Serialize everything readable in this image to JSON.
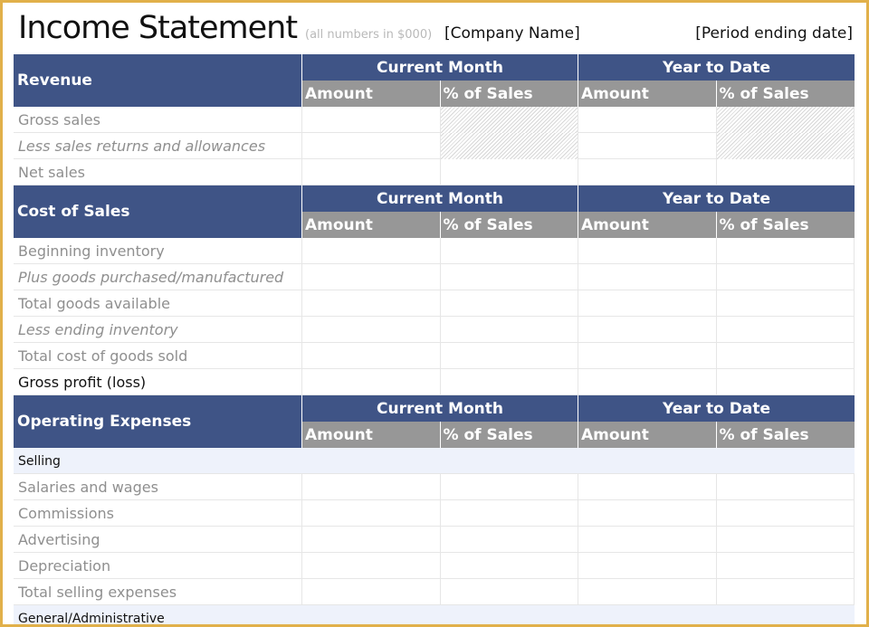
{
  "header": {
    "title": "Income Statement",
    "note": "(all numbers in $000)",
    "company": "[Company Name]",
    "period": "[Period ending date]"
  },
  "colors": {
    "frame": "#e1b04a",
    "section_header": "#3f5486",
    "subheader": "#979797",
    "subsection_fill": "#eef2fb"
  },
  "columns": {
    "group_current": "Current Month",
    "group_ytd": "Year to Date",
    "amount": "Amount",
    "pct": "% of Sales"
  },
  "revenue": {
    "title": "Revenue",
    "rows": [
      {
        "label": "Gross sales"
      },
      {
        "label": "Less sales returns and allowances"
      },
      {
        "label": "Net sales"
      }
    ]
  },
  "cost_of_sales": {
    "title": "Cost of Sales",
    "rows": [
      {
        "label": "Beginning inventory"
      },
      {
        "label": "Plus goods purchased/manufactured"
      },
      {
        "label": "Total goods available"
      },
      {
        "label": "Less ending inventory"
      },
      {
        "label": "Total cost of goods sold"
      },
      {
        "label": "Gross profit (loss)"
      }
    ]
  },
  "operating_expenses": {
    "title": "Operating Expenses",
    "selling_label": "Selling",
    "rows": [
      {
        "label": "Salaries and wages"
      },
      {
        "label": "Commissions"
      },
      {
        "label": "Advertising"
      },
      {
        "label": "Depreciation"
      },
      {
        "label": "Total selling expenses"
      }
    ],
    "general_label": "General/Administrative"
  }
}
